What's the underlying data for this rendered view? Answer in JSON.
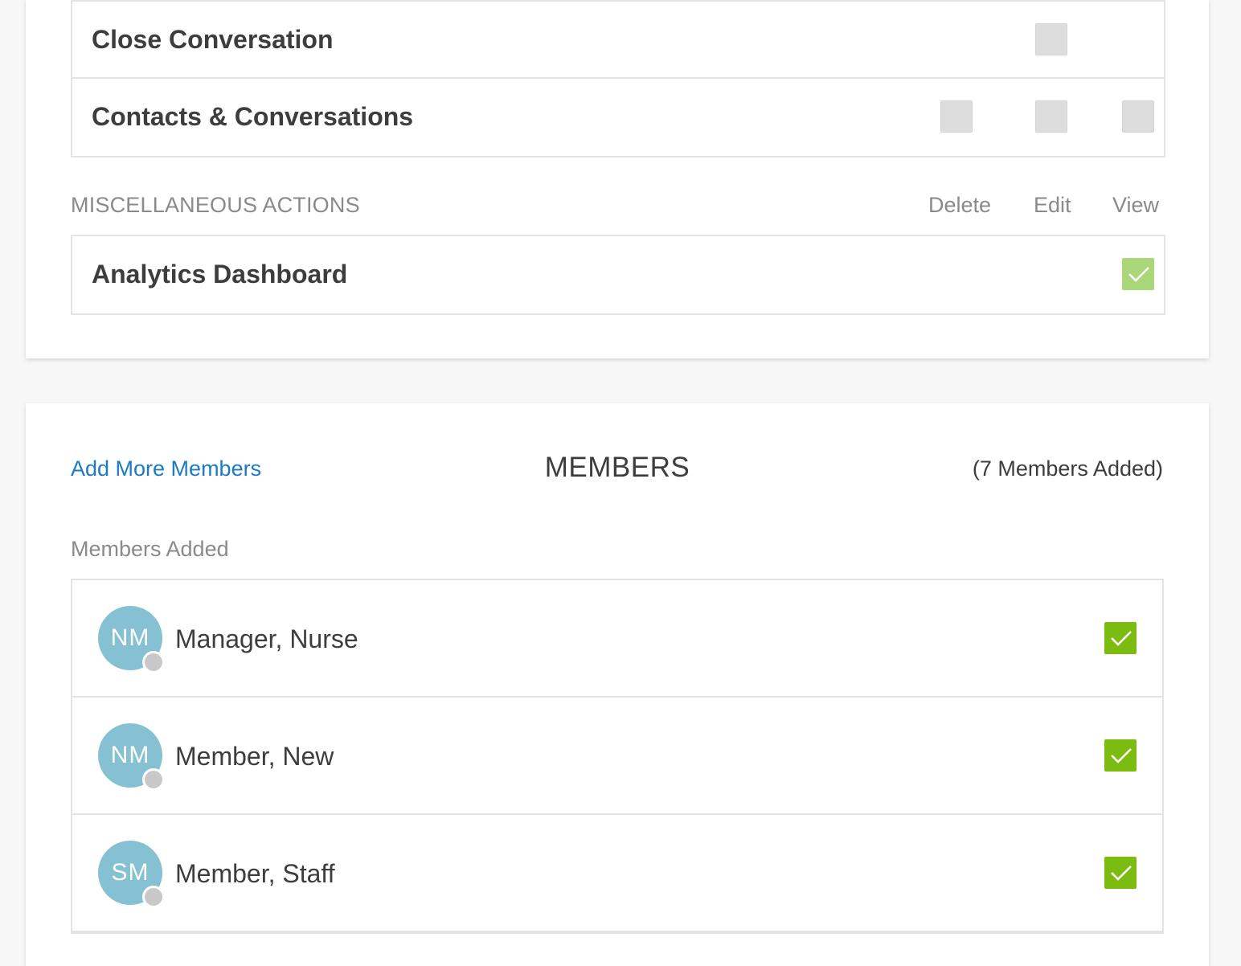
{
  "permissions": {
    "rows": [
      {
        "label": "Close Conversation"
      },
      {
        "label": "Contacts & Conversations"
      }
    ]
  },
  "misc": {
    "section_title": "MISCELLANEOUS ACTIONS",
    "columns": {
      "delete": "Delete",
      "edit": "Edit",
      "view": "View"
    },
    "rows": [
      {
        "label": "Analytics Dashboard"
      }
    ]
  },
  "members": {
    "add_link": "Add More Members",
    "title": "MEMBERS",
    "count_text": "(7 Members Added)",
    "added_label": "Members Added",
    "list": [
      {
        "initials": "NM",
        "name": "Manager, Nurse"
      },
      {
        "initials": "NM",
        "name": "Member, New"
      },
      {
        "initials": "SM",
        "name": "Member, Staff"
      }
    ]
  },
  "colors": {
    "checked_green": "#7cbb10",
    "checked_light_green": "#a9d77a",
    "unchecked_gray": "#dddddd",
    "link_blue": "#1a7bc4",
    "avatar_blue": "#85c1d3"
  },
  "icons": [
    "checkmark-icon",
    "presence-status-icon"
  ]
}
